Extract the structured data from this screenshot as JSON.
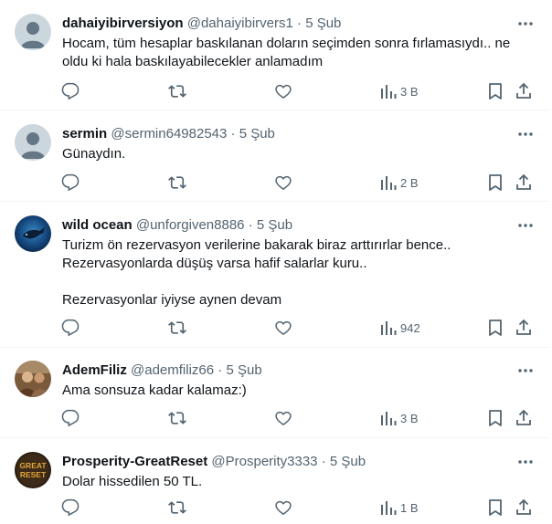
{
  "colors": {
    "text": "#0f1419",
    "secondary": "#536471",
    "divider": "#eff3f4"
  },
  "tweets": [
    {
      "name": "dahaiyibirversiyon",
      "handle": "@dahaiyibirvers1",
      "dot": "·",
      "date": "5 Şub",
      "avatar": "default-avatar",
      "lines": [
        "Hocam, tüm hesaplar baskılanan doların seçimden sonra fırlamasıydı.. ne",
        "oldu ki hala baskılayabilecekler anlamadım"
      ],
      "views": "3 B"
    },
    {
      "name": "sermin",
      "handle": "@sermin64982543",
      "dot": "·",
      "date": "5 Şub",
      "avatar": "default-avatar",
      "lines": [
        "Günaydın."
      ],
      "views": "2 B"
    },
    {
      "name": "wild ocean",
      "handle": "@unforgiven8886",
      "dot": "·",
      "date": "5 Şub",
      "avatar": "ocean-avatar",
      "lines": [
        "Turizm ön rezervasyon verilerine bakarak biraz arttırırlar bence..",
        "Rezervasyonlarda düşüş varsa hafif salarlar kuru..",
        "",
        "Rezervasyonlar iyiyse aynen devam"
      ],
      "views": "942"
    },
    {
      "name": "AdemFiliz",
      "handle": "@ademfiliz66",
      "dot": "·",
      "date": "5 Şub",
      "avatar": "photo-avatar",
      "lines": [
        "Ama sonsuza kadar kalamaz:)"
      ],
      "views": "3 B"
    },
    {
      "name": "Prosperity-GreatReset",
      "handle": "@Prosperity3333",
      "dot": "·",
      "date": "5 Şub",
      "avatar": "great-reset-avatar",
      "avatar_text": [
        "GREAT",
        "RESET"
      ],
      "lines": [
        "Dolar hissedilen 50 TL."
      ],
      "views": "1 B"
    }
  ]
}
